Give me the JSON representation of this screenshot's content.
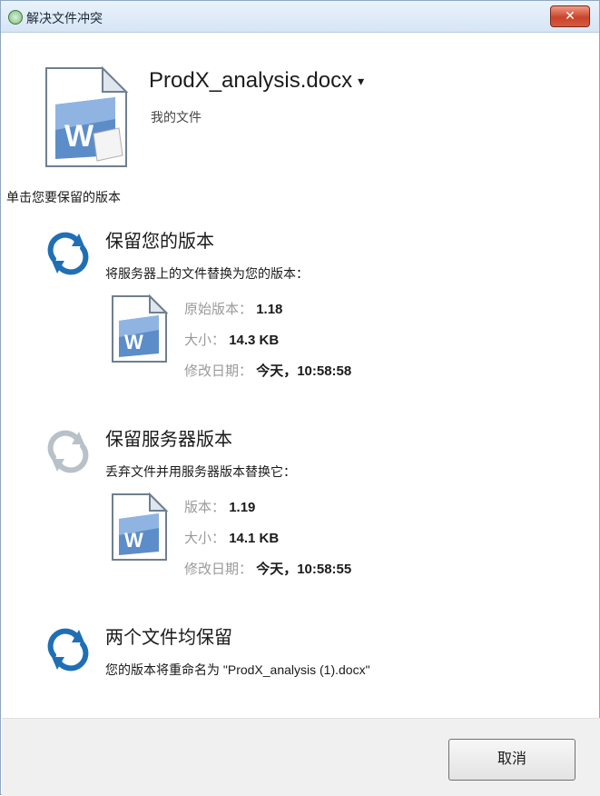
{
  "window": {
    "title": "解决文件冲突",
    "close_label": "✕"
  },
  "file": {
    "name": "ProdX_analysis.docx",
    "caret": "▾",
    "location": "我的文件"
  },
  "instruction": "单击您要保留的版本",
  "options": [
    {
      "title": "保留您的版本",
      "description": "将服务器上的文件替换为您的版本：",
      "details": [
        {
          "label": "原始版本：",
          "value": "1.18"
        },
        {
          "label": "大小：",
          "value": "14.3 KB"
        },
        {
          "label": "修改日期：",
          "value": "今天，10:58:58"
        }
      ]
    },
    {
      "title": "保留服务器版本",
      "description": "丢弃文件并用服务器版本替换它：",
      "details": [
        {
          "label": "版本：",
          "value": "1.19"
        },
        {
          "label": "大小：",
          "value": "14.1 KB"
        },
        {
          "label": "修改日期：",
          "value": "今天，10:58:55"
        }
      ]
    },
    {
      "title": "两个文件均保留",
      "description": "您的版本将重命名为 \"ProdX_analysis (1).docx\""
    }
  ],
  "footer": {
    "cancel_label": "取消"
  },
  "icons": {
    "window": "app-icon",
    "file": "word-document-icon",
    "option": "sync-arrows-icon"
  },
  "colors": {
    "sync_active": "#1f6fb5",
    "sync_inactive": "#b8c1c9",
    "label_gray": "#9a9a9a"
  }
}
